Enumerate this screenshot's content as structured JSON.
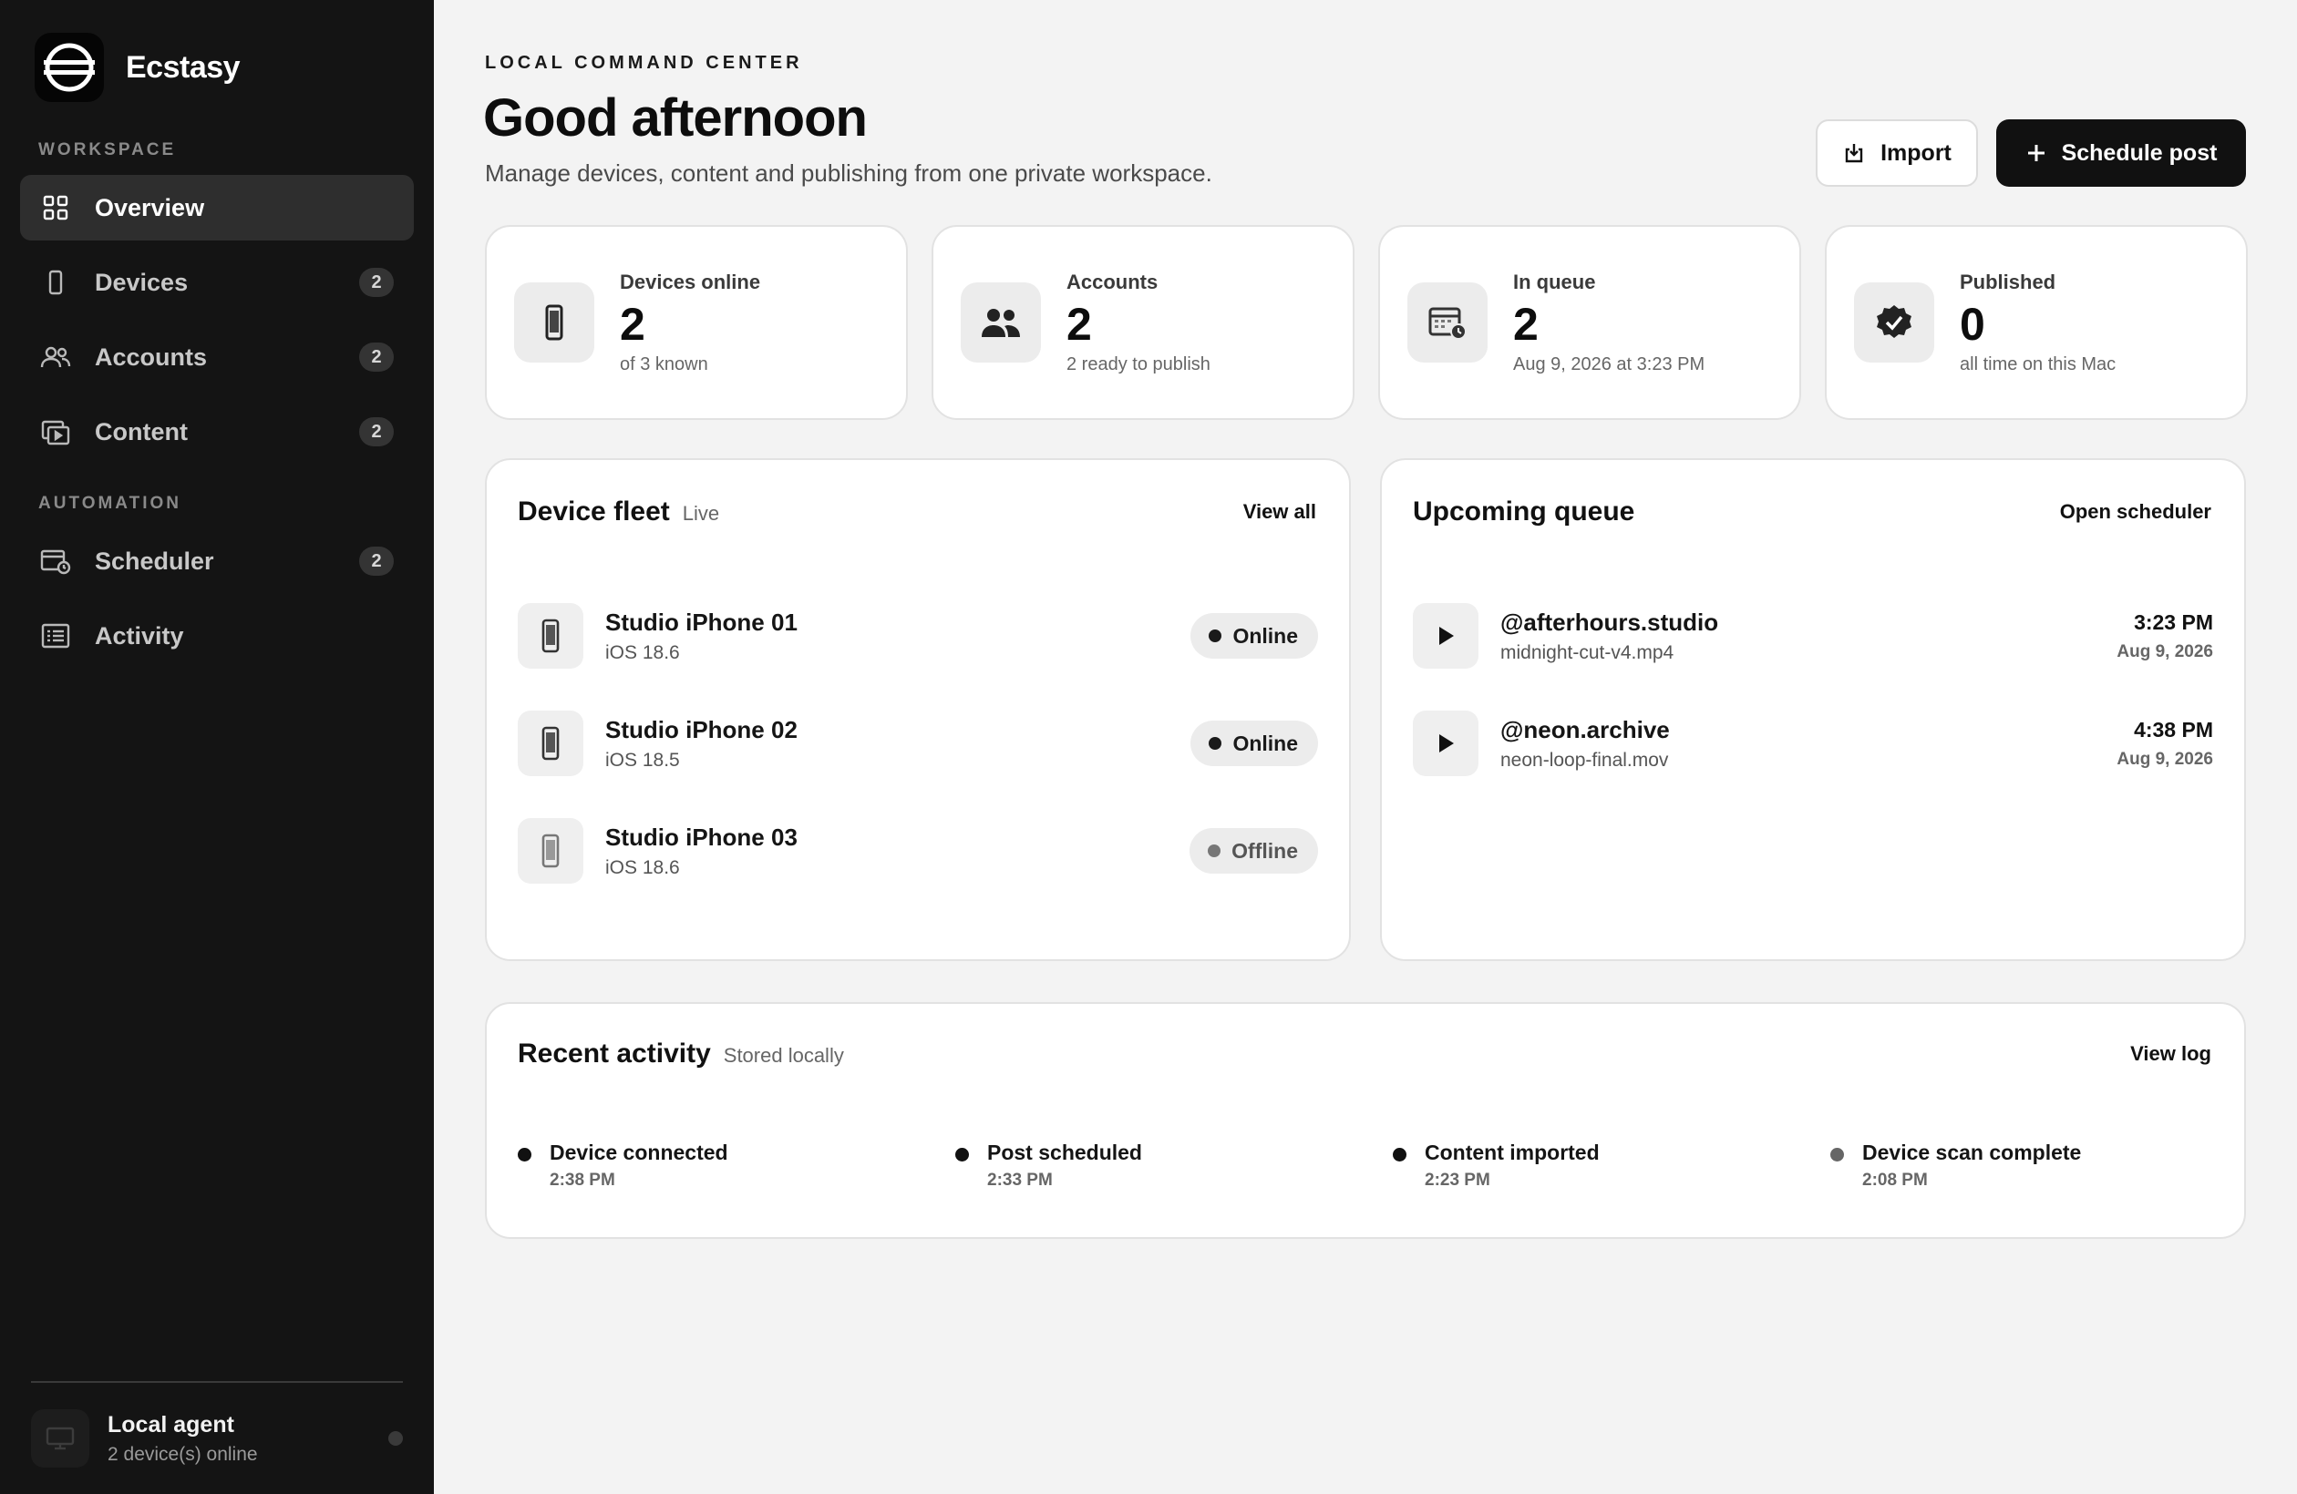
{
  "brand": {
    "name": "Ecstasy"
  },
  "sidebar": {
    "sections": [
      {
        "label": "WORKSPACE"
      },
      {
        "label": "AUTOMATION"
      }
    ],
    "items": [
      {
        "label": "Overview",
        "badge": ""
      },
      {
        "label": "Devices",
        "badge": "2"
      },
      {
        "label": "Accounts",
        "badge": "2"
      },
      {
        "label": "Content",
        "badge": "2"
      },
      {
        "label": "Scheduler",
        "badge": "2"
      },
      {
        "label": "Activity",
        "badge": ""
      }
    ],
    "footer": {
      "title": "Local agent",
      "subtitle": "2 device(s) online"
    }
  },
  "header": {
    "eyebrow": "LOCAL COMMAND CENTER",
    "title": "Good afternoon",
    "subtitle": "Manage devices, content and publishing from one private workspace.",
    "import_label": "Import",
    "schedule_label": "Schedule post"
  },
  "stats": [
    {
      "label": "Devices online",
      "value": "2",
      "sub": "of 3 known",
      "icon": "phone-icon"
    },
    {
      "label": "Accounts",
      "value": "2",
      "sub": "2 ready to publish",
      "icon": "users-icon"
    },
    {
      "label": "In queue",
      "value": "2",
      "sub": "Aug 9, 2026 at 3:23 PM",
      "icon": "calendar-clock-icon"
    },
    {
      "label": "Published",
      "value": "0",
      "sub": "all time on this Mac",
      "icon": "verified-badge-icon"
    }
  ],
  "fleet": {
    "title": "Device fleet",
    "tag": "Live",
    "link": "View all",
    "devices": [
      {
        "name": "Studio iPhone 01",
        "os": "iOS 18.6",
        "status": "Online"
      },
      {
        "name": "Studio iPhone 02",
        "os": "iOS 18.5",
        "status": "Online"
      },
      {
        "name": "Studio iPhone 03",
        "os": "iOS 18.6",
        "status": "Offline"
      }
    ]
  },
  "queue": {
    "title": "Upcoming queue",
    "link": "Open scheduler",
    "items": [
      {
        "account": "@afterhours.studio",
        "file": "midnight-cut-v4.mp4",
        "time": "3:23 PM",
        "date": "Aug 9, 2026"
      },
      {
        "account": "@neon.archive",
        "file": "neon-loop-final.mov",
        "time": "4:38 PM",
        "date": "Aug 9, 2026"
      }
    ]
  },
  "activity": {
    "title": "Recent activity",
    "tag": "Stored locally",
    "link": "View log",
    "events": [
      {
        "title": "Device connected",
        "time": "2:38 PM"
      },
      {
        "title": "Post scheduled",
        "time": "2:33 PM"
      },
      {
        "title": "Content imported",
        "time": "2:23 PM"
      },
      {
        "title": "Device scan complete",
        "time": "2:08 PM"
      }
    ]
  }
}
